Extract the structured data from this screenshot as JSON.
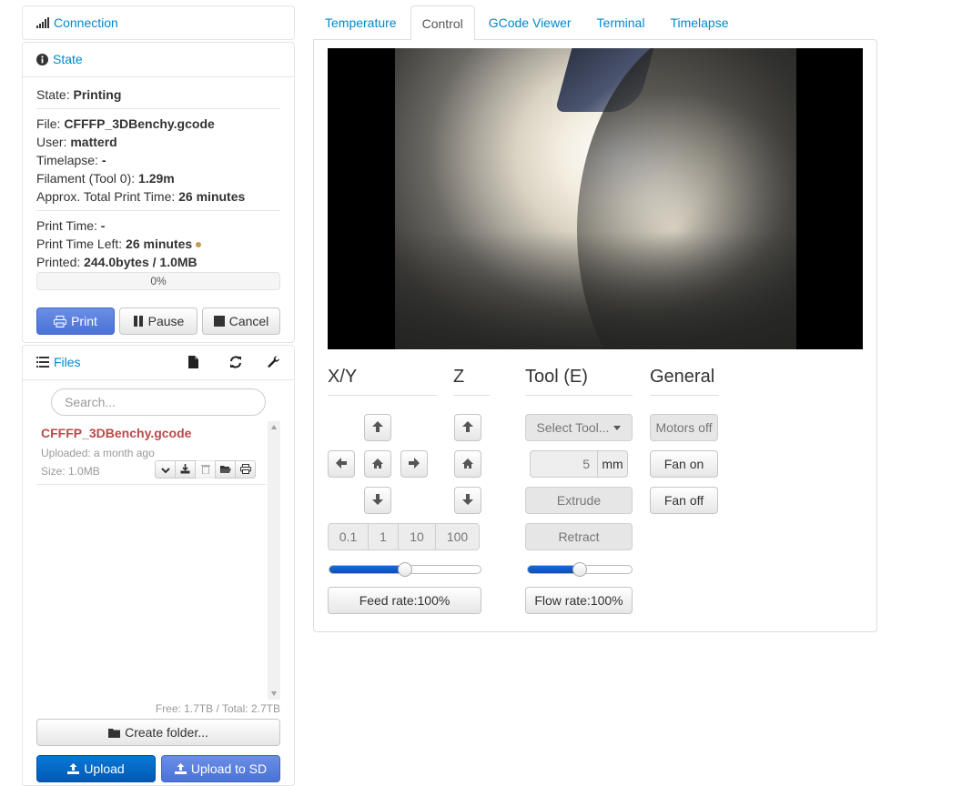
{
  "sidebar": {
    "connection": {
      "title": "Connection"
    },
    "state": {
      "title": "State",
      "state_label": "State:",
      "state_value": "Printing",
      "file_label": "File:",
      "file_value": "CFFFP_3DBenchy.gcode",
      "user_label": "User:",
      "user_value": "matterd",
      "timelapse_label": "Timelapse:",
      "timelapse_value": "-",
      "filament_label": "Filament (Tool 0):",
      "filament_value": "1.29m",
      "approx_label": "Approx. Total Print Time:",
      "approx_value": "26 minutes",
      "printtime_label": "Print Time:",
      "printtime_value": "-",
      "timeleft_label": "Print Time Left:",
      "timeleft_value": "26 minutes",
      "printed_label": "Printed:",
      "printed_value": "244.0bytes / 1.0MB",
      "progress_text": "0%",
      "progress_fraction": 0.0,
      "buttons": {
        "print": "Print",
        "pause": "Pause",
        "cancel": "Cancel"
      }
    },
    "files": {
      "title": "Files",
      "search_placeholder": "Search...",
      "items": [
        {
          "name": "CFFFP_3DBenchy.gcode",
          "uploaded": "Uploaded: a month ago",
          "size": "Size: 1.0MB"
        }
      ],
      "free_space": "Free: 1.7TB / Total: 2.7TB",
      "create_folder": "Create folder...",
      "upload": "Upload",
      "upload_sd": "Upload to SD"
    }
  },
  "tabs": [
    "Temperature",
    "Control",
    "GCode Viewer",
    "Terminal",
    "Timelapse"
  ],
  "active_tab": "Control",
  "control": {
    "xy_title": "X/Y",
    "z_title": "Z",
    "tool_title": "Tool (E)",
    "general_title": "General",
    "steps": [
      "0.1",
      "1",
      "10",
      "100"
    ],
    "feed_rate": "Feed rate:100%",
    "feed_rate_level": 0.5,
    "flow_rate": "Flow rate:100%",
    "flow_rate_level": 0.5,
    "select_tool": "Select Tool...",
    "extrude_amount": "5",
    "extrude_unit": "mm",
    "extrude": "Extrude",
    "retract": "Retract",
    "motors_off": "Motors off",
    "fan_on": "Fan on",
    "fan_off": "Fan off"
  },
  "colors": {
    "link": "#0088cc",
    "file_name": "#b94a48",
    "primary": "#4a72d6",
    "upload_blue": "#0a6fd0",
    "slider_blue": "#1a6ad6"
  }
}
